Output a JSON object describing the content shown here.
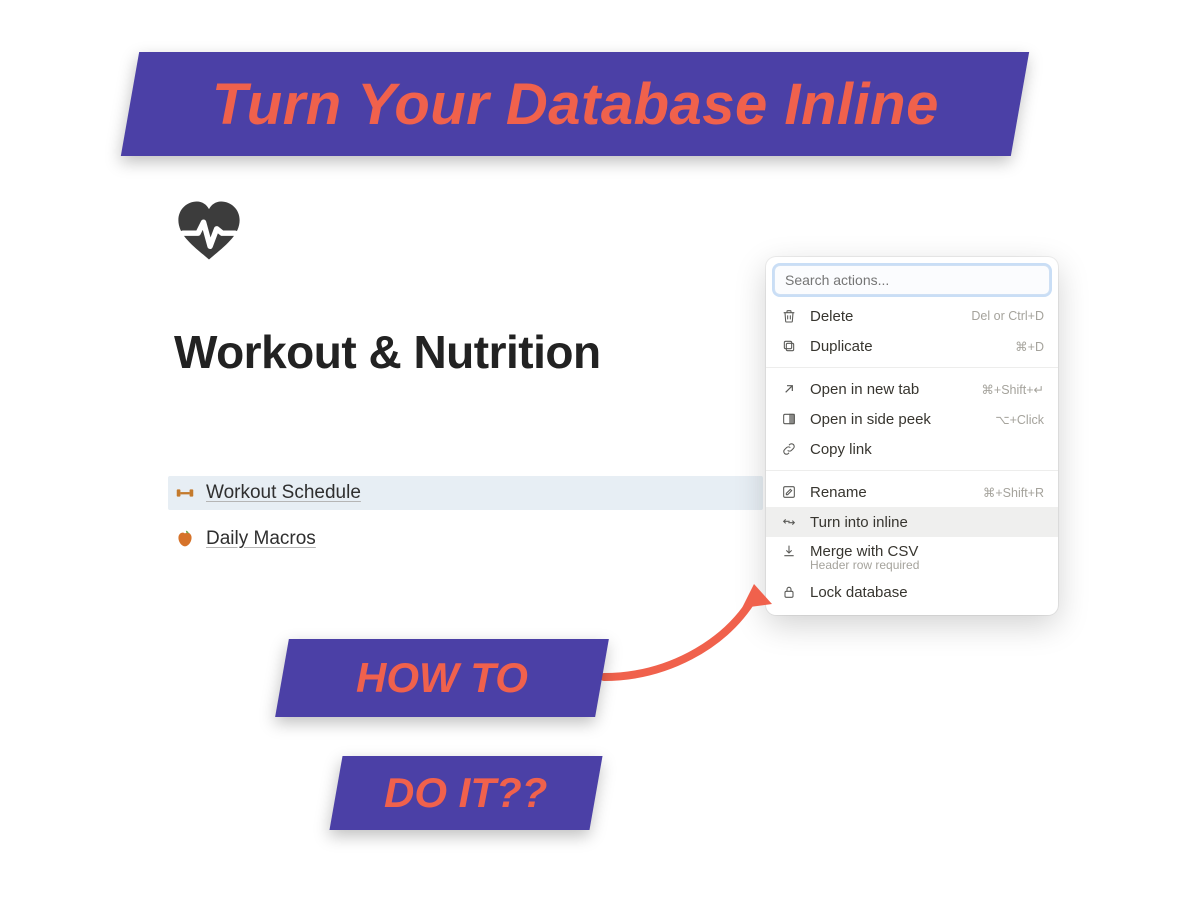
{
  "banners": {
    "title": "Turn Your Database Inline",
    "how": "HOW TO",
    "doit": "DO IT??"
  },
  "page": {
    "title": "Workout & Nutrition",
    "links": [
      {
        "icon": "dumbbell-icon",
        "label": "Workout Schedule",
        "selected": true
      },
      {
        "icon": "apple-icon",
        "label": "Daily Macros",
        "selected": false
      }
    ]
  },
  "context_menu": {
    "search_placeholder": "Search actions...",
    "groups": [
      [
        {
          "icon": "trash-icon",
          "label": "Delete",
          "shortcut": "Del or Ctrl+D"
        },
        {
          "icon": "duplicate-icon",
          "label": "Duplicate",
          "shortcut": "⌘+D"
        }
      ],
      [
        {
          "icon": "arrow-up-right-icon",
          "label": "Open in new tab",
          "shortcut": "⌘+Shift+↵"
        },
        {
          "icon": "side-peek-icon",
          "label": "Open in side peek",
          "shortcut": "⌥+Click"
        },
        {
          "icon": "link-icon",
          "label": "Copy link",
          "shortcut": ""
        }
      ],
      [
        {
          "icon": "rename-icon",
          "label": "Rename",
          "shortcut": "⌘+Shift+R"
        },
        {
          "icon": "turn-into-icon",
          "label": "Turn into inline",
          "shortcut": "",
          "highlight": true
        },
        {
          "icon": "download-icon",
          "label": "Merge with CSV",
          "sub": "Header row required"
        },
        {
          "icon": "lock-icon",
          "label": "Lock database",
          "shortcut": ""
        }
      ]
    ]
  },
  "colors": {
    "banner_bg": "#4b40a6",
    "banner_text": "#f0614c",
    "arrow": "#f0614c"
  }
}
